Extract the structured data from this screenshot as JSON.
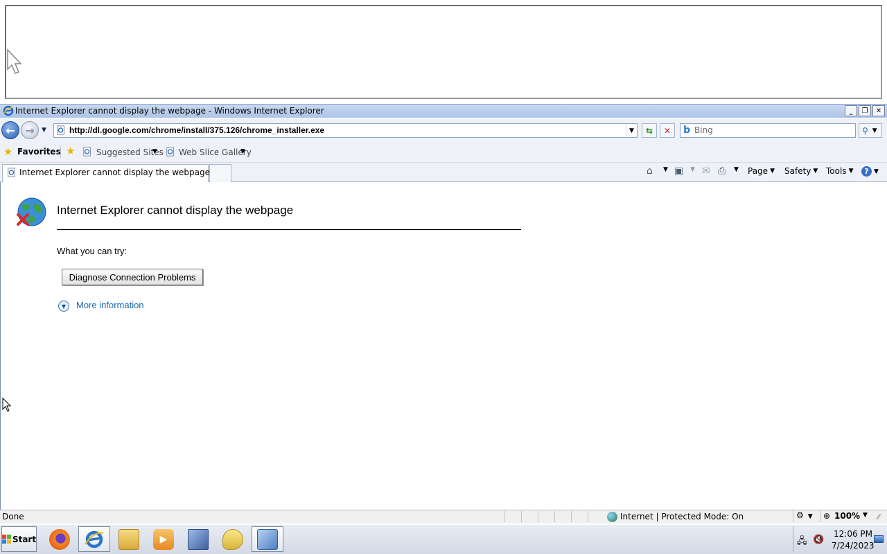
{
  "window": {
    "title": "Internet Explorer cannot display the webpage - Windows Internet Explorer",
    "controls": {
      "minimize": "_",
      "restore": "❐",
      "close": "✕"
    }
  },
  "address_bar": {
    "url": "http://dl.google.com/chrome/install/375.126/chrome_installer.exe",
    "search_placeholder": "Bing"
  },
  "favorites_bar": {
    "favorites_label": "Favorites",
    "links": [
      {
        "label": "Suggested Sites"
      },
      {
        "label": "Web Slice Gallery"
      }
    ]
  },
  "tabs": [
    {
      "label": "Internet Explorer cannot display the webpage"
    }
  ],
  "command_bar": {
    "page": "Page",
    "safety": "Safety",
    "tools": "Tools"
  },
  "content": {
    "heading": "Internet Explorer cannot display the webpage",
    "try_label": "What you can try:",
    "diagnose_button": "Diagnose Connection Problems",
    "more_info": "More information"
  },
  "status_bar": {
    "status": "Done",
    "zone": "Internet | Protected Mode: On",
    "zoom": "100%"
  },
  "taskbar": {
    "start": "Start",
    "apps": [
      {
        "name": "firefox-icon",
        "color": "#e8631a"
      },
      {
        "name": "internet-explorer-icon",
        "color": "#2a76c9"
      },
      {
        "name": "file-explorer-icon",
        "color": "#e6c25a"
      },
      {
        "name": "media-player-icon",
        "color": "#f0a23a"
      },
      {
        "name": "network-tool-icon",
        "color": "#4a6fb0"
      },
      {
        "name": "messenger-icon",
        "color": "#e4c84e"
      },
      {
        "name": "control-panel-icon",
        "color": "#5b8fcf"
      }
    ],
    "clock_time": "12:06 PM",
    "clock_date": "7/24/2023"
  }
}
